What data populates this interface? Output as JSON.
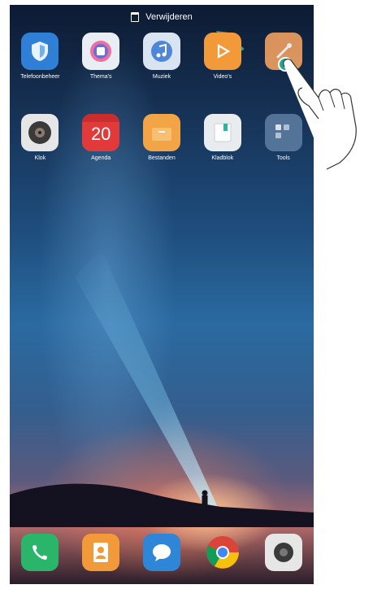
{
  "topbar": {
    "remove_label": "Verwijderen"
  },
  "row1": [
    {
      "label": "Telefoonbeheer",
      "icon": "shield-icon",
      "color": "#2f7fd6"
    },
    {
      "label": "Thema's",
      "icon": "themes-icon",
      "color": "#e9eef5"
    },
    {
      "label": "Muziek",
      "icon": "music-icon",
      "color": "#d9e4f3"
    },
    {
      "label": "Video's",
      "icon": "video-icon",
      "color": "#f29a3a"
    },
    {
      "label": "",
      "icon": "dragged-app-icon",
      "color": "#f0a060"
    }
  ],
  "row2": [
    {
      "label": "Klok",
      "icon": "clock-icon",
      "color": "#e6e6e6"
    },
    {
      "label": "Agenda",
      "icon": "calendar-icon",
      "color": "#e23a3a",
      "day": "20"
    },
    {
      "label": "Bestanden",
      "icon": "folder-icon",
      "color": "#f2a446"
    },
    {
      "label": "Kladblok",
      "icon": "notepad-icon",
      "color": "#e9ecef"
    },
    {
      "label": "Tools",
      "icon": "tools-folder-icon",
      "color": "#5f7ea3"
    }
  ],
  "dock": [
    {
      "icon": "phone-icon",
      "color": "#2ab56a"
    },
    {
      "icon": "contacts-icon",
      "color": "#f29a3a"
    },
    {
      "icon": "messages-icon",
      "color": "#2f86d6"
    },
    {
      "icon": "browser-icon",
      "color": "#ffffff"
    },
    {
      "icon": "camera-icon",
      "color": "#e6e6e6"
    }
  ]
}
